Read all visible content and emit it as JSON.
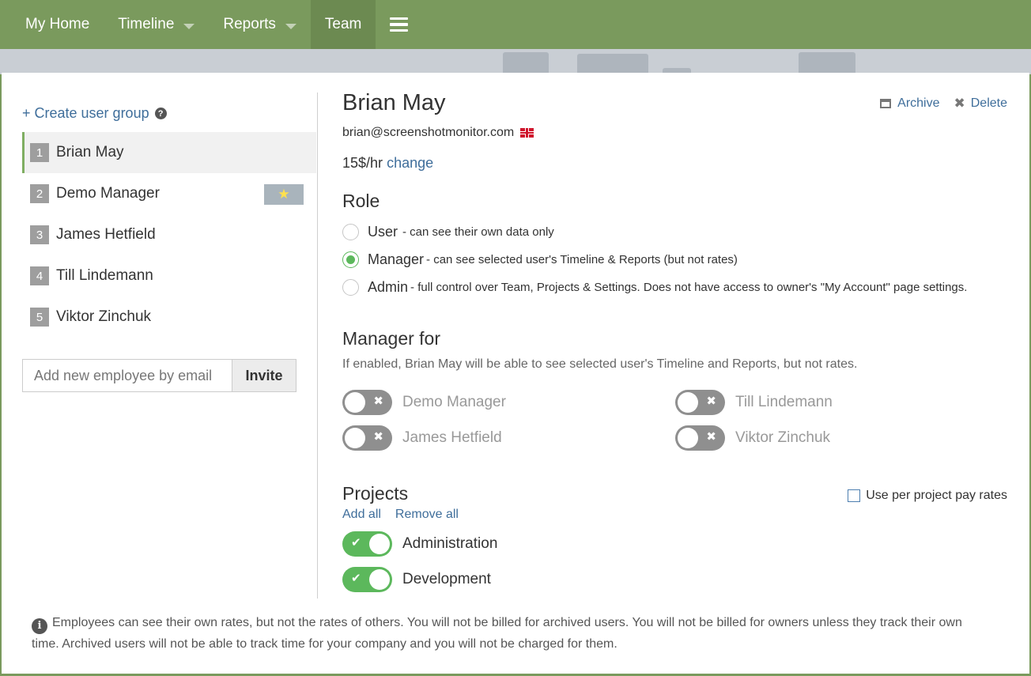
{
  "nav": {
    "items": [
      {
        "label": "My Home",
        "dropdown": false,
        "active": false
      },
      {
        "label": "Timeline",
        "dropdown": true,
        "active": false
      },
      {
        "label": "Reports",
        "dropdown": true,
        "active": false
      },
      {
        "label": "Team",
        "dropdown": false,
        "active": true
      }
    ],
    "menu_icon": "hamburger-icon"
  },
  "sidebar": {
    "create_group_label": "+ Create user group",
    "help_icon": "question-circle-icon",
    "users": [
      {
        "num": "1",
        "name": "Brian May",
        "selected": true,
        "star": false
      },
      {
        "num": "2",
        "name": "Demo Manager",
        "selected": false,
        "star": true
      },
      {
        "num": "3",
        "name": "James Hetfield",
        "selected": false,
        "star": false
      },
      {
        "num": "4",
        "name": "Till Lindemann",
        "selected": false,
        "star": false
      },
      {
        "num": "5",
        "name": "Viktor Zinchuk",
        "selected": false,
        "star": false
      }
    ],
    "star_icon": "★",
    "invite_placeholder": "Add new employee by email",
    "invite_button": "Invite"
  },
  "detail": {
    "name": "Brian May",
    "archive_label": "Archive",
    "delete_label": "Delete",
    "email": "brian@screenshotmonitor.com",
    "rate": "15$/hr",
    "rate_change_link": "change",
    "role_title": "Role",
    "roles": [
      {
        "label": "User",
        "desc": "- can see their own data only",
        "checked": false
      },
      {
        "label": "Manager",
        "desc": "- can see selected user's Timeline & Reports (but not rates)",
        "checked": true
      },
      {
        "label": "Admin",
        "desc": "- full control over Team, Projects & Settings. Does not have access to owner's \"My Account\" page settings.",
        "checked": false
      }
    ],
    "manager_for_title": "Manager for",
    "manager_for_desc": "If enabled, Brian May will be able to see selected user's Timeline and Reports, but not rates.",
    "manager_for": [
      {
        "name": "Demo Manager",
        "enabled": false
      },
      {
        "name": "Till Lindemann",
        "enabled": false
      },
      {
        "name": "James Hetfield",
        "enabled": false
      },
      {
        "name": "Viktor Zinchuk",
        "enabled": false
      }
    ],
    "projects_title": "Projects",
    "per_project_label": "Use per project pay rates",
    "add_all": "Add all",
    "remove_all": "Remove all",
    "projects": [
      {
        "name": "Administration",
        "enabled": true
      },
      {
        "name": "Development",
        "enabled": true
      }
    ]
  },
  "footer_note": "Employees can see their own rates, but not the rates of others. You will not be billed for archived users. You will not be billed for owners unless they track their own time. Archived users will not be able to track time for your company and you will not be charged for them.",
  "colors": {
    "nav": "#7a9a5d",
    "accent_green": "#5cb85c",
    "link": "#3f6e9b"
  }
}
